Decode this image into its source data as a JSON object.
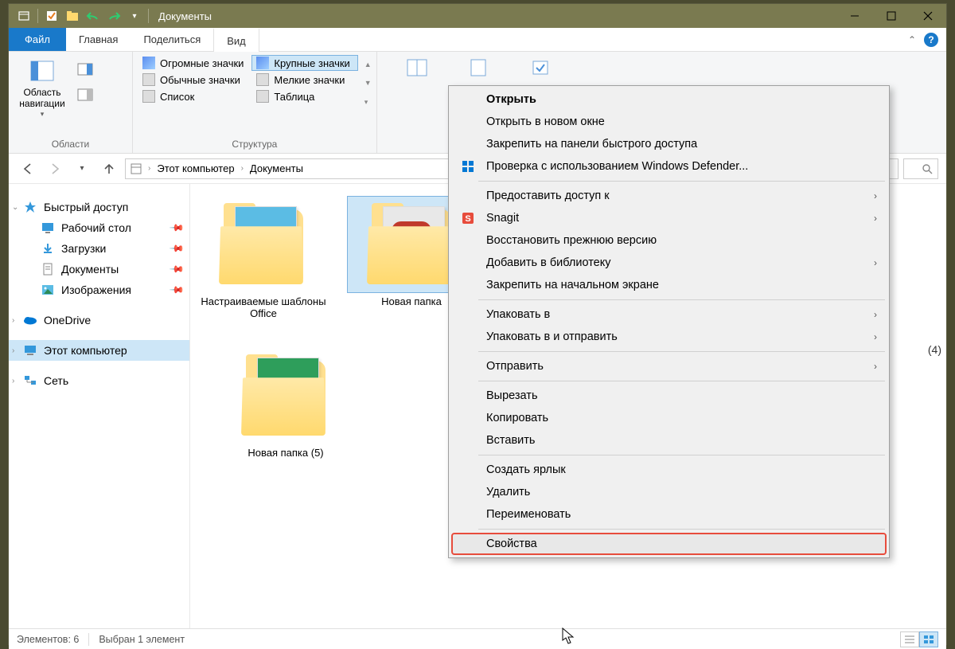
{
  "window": {
    "title": "Документы"
  },
  "ribbon": {
    "tabs": {
      "file": "Файл",
      "home": "Главная",
      "share": "Поделиться",
      "view": "Вид"
    },
    "panes_group": {
      "nav_pane": "Область навигации",
      "label": "Области"
    },
    "layout_group": {
      "label": "Структура",
      "items": {
        "extra_large": "Огромные значки",
        "large": "Крупные значки",
        "medium": "Обычные значки",
        "small": "Мелкие значки",
        "list": "Список",
        "tiles": "Таблица"
      }
    }
  },
  "breadcrumb": {
    "root": "Этот компьютер",
    "current": "Документы"
  },
  "sidebar": {
    "quick_access": "Быстрый доступ",
    "desktop": "Рабочий стол",
    "downloads": "Загрузки",
    "documents": "Документы",
    "pictures": "Изображения",
    "onedrive": "OneDrive",
    "this_pc": "Этот компьютер",
    "network": "Сеть"
  },
  "files": {
    "item1": "Настраиваемые шаблоны Office",
    "item2": "Новая папка",
    "item3": "Новая папка (5)",
    "hidden_right": "(4)"
  },
  "context_menu": {
    "open": "Открыть",
    "open_new_window": "Открыть в новом окне",
    "pin_quick_access": "Закрепить на панели быстрого доступа",
    "defender": "Проверка с использованием Windows Defender...",
    "share_access": "Предоставить доступ к",
    "snagit": "Snagit",
    "restore_previous": "Восстановить прежнюю версию",
    "add_library": "Добавить в библиотеку",
    "pin_start": "Закрепить на начальном экране",
    "pack": "Упаковать в",
    "pack_send": "Упаковать в и отправить",
    "send_to": "Отправить",
    "cut": "Вырезать",
    "copy": "Копировать",
    "paste": "Вставить",
    "create_shortcut": "Создать ярлык",
    "delete": "Удалить",
    "rename": "Переименовать",
    "properties": "Свойства"
  },
  "statusbar": {
    "count": "Элементов: 6",
    "selected": "Выбран 1 элемент"
  }
}
